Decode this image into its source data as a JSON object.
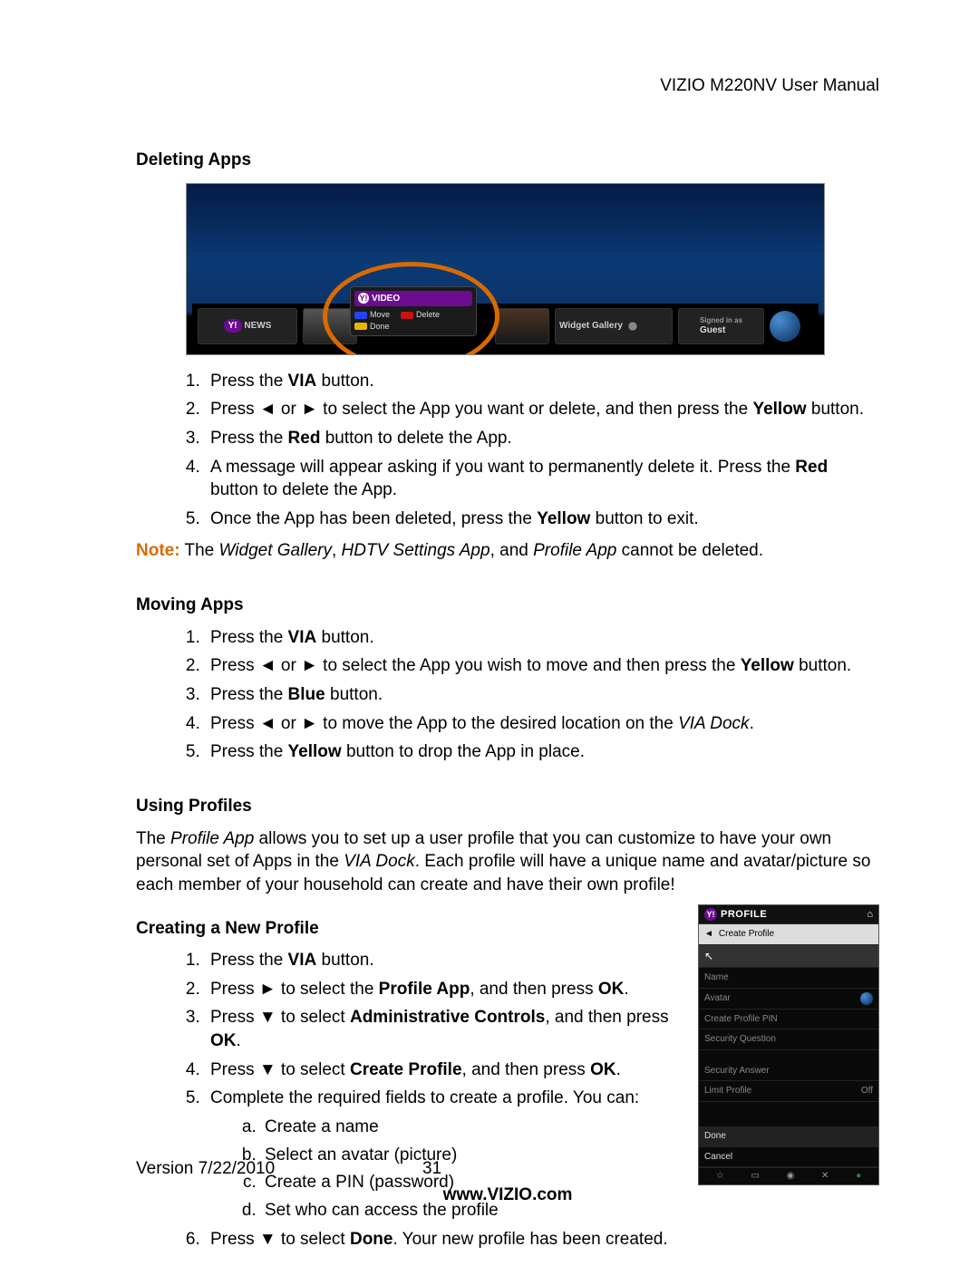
{
  "header": {
    "right": "VIZIO M220NV User Manual"
  },
  "deleting": {
    "title": "Deleting Apps",
    "screenshot": {
      "news_label": "NEWS",
      "popup_title": "VIDEO",
      "move": "Move",
      "delete": "Delete",
      "done": "Done",
      "widget_gallery": "Widget Gallery",
      "signed_as": "Signed in as",
      "guest": "Guest"
    },
    "steps": {
      "s1_a": "Press the ",
      "s1_b": "VIA",
      "s1_c": " button.",
      "s2_a": "Press ◄ or ► to select the App you want or delete, and then press the ",
      "s2_b": "Yellow",
      "s2_c": " button.",
      "s3_a": "Press the ",
      "s3_b": "Red",
      "s3_c": " button to delete the App.",
      "s4_a": "A message will appear asking if you want to permanently delete it. Press the ",
      "s4_b": "Red",
      "s4_c": " button to delete the App.",
      "s5_a": "Once the App has been deleted, press the ",
      "s5_b": "Yellow",
      "s5_c": " button to exit."
    },
    "note_label": "Note:",
    "note_a": " The ",
    "note_i1": "Widget Gallery",
    "note_b": ", ",
    "note_i2": "HDTV Settings App",
    "note_c": ", and ",
    "note_i3": "Profile App",
    "note_d": " cannot be deleted."
  },
  "moving": {
    "title": "Moving Apps",
    "steps": {
      "s1_a": "Press the ",
      "s1_b": "VIA",
      "s1_c": " button.",
      "s2_a": "Press ◄ or ► to select the App you wish to move and then press the ",
      "s2_b": "Yellow",
      "s2_c": " button.",
      "s3_a": "Press the ",
      "s3_b": "Blue",
      "s3_c": " button.",
      "s4_a": "Press ◄ or ► to move the App to the desired location on the ",
      "s4_i": "VIA Dock",
      "s4_c": ".",
      "s5_a": "Press the ",
      "s5_b": "Yellow",
      "s5_c": " button to drop the App in place."
    }
  },
  "profiles": {
    "title": "Using Profiles",
    "intro_a": "The ",
    "intro_i": "Profile App",
    "intro_b": " allows you to set up a user profile that you can customize to have your own personal set of Apps in the ",
    "intro_i2": "VIA Dock",
    "intro_c": ". Each profile will have a unique name and avatar/picture so each member of your household can create and have their own profile!"
  },
  "creating": {
    "title": "Creating a New Profile",
    "steps": {
      "s1_a": "Press the ",
      "s1_b": "VIA",
      "s1_c": " button.",
      "s2_a": "Press ► to select the ",
      "s2_b": "Profile App",
      "s2_c": ", and then press ",
      "s2_d": "OK",
      "s2_e": ".",
      "s3_a": "Press ▼ to select ",
      "s3_b": "Administrative Controls",
      "s3_c": ", and then press ",
      "s3_d": "OK",
      "s3_e": ".",
      "s4_a": "Press ▼ to select ",
      "s4_b": "Create Profile",
      "s4_c": ", and then press ",
      "s4_d": "OK",
      "s4_e": ".",
      "s5": "Complete the required fields to create a profile. You can:",
      "sub_a": "Create a name",
      "sub_b": "Select an avatar (picture)",
      "sub_c": "Create a PIN (password)",
      "sub_d": "Set who can access the profile",
      "s6_a": "Press ▼ to select ",
      "s6_b": "Done",
      "s6_c": ". Your new profile has been created."
    }
  },
  "profile_shot": {
    "title": "PROFILE",
    "create_profile": "Create Profile",
    "name": "Name",
    "avatar": "Avatar",
    "create_pin": "Create Profile PIN",
    "security_q": "Security Question",
    "security_a": "Security Answer",
    "limit": "Limit Profile",
    "limit_val": "Off",
    "done": "Done",
    "cancel": "Cancel",
    "back_arrow": "◄",
    "home": "⌂"
  },
  "footer": {
    "version": "Version 7/22/2010",
    "page": "31",
    "url": "www.VIZIO.com"
  }
}
